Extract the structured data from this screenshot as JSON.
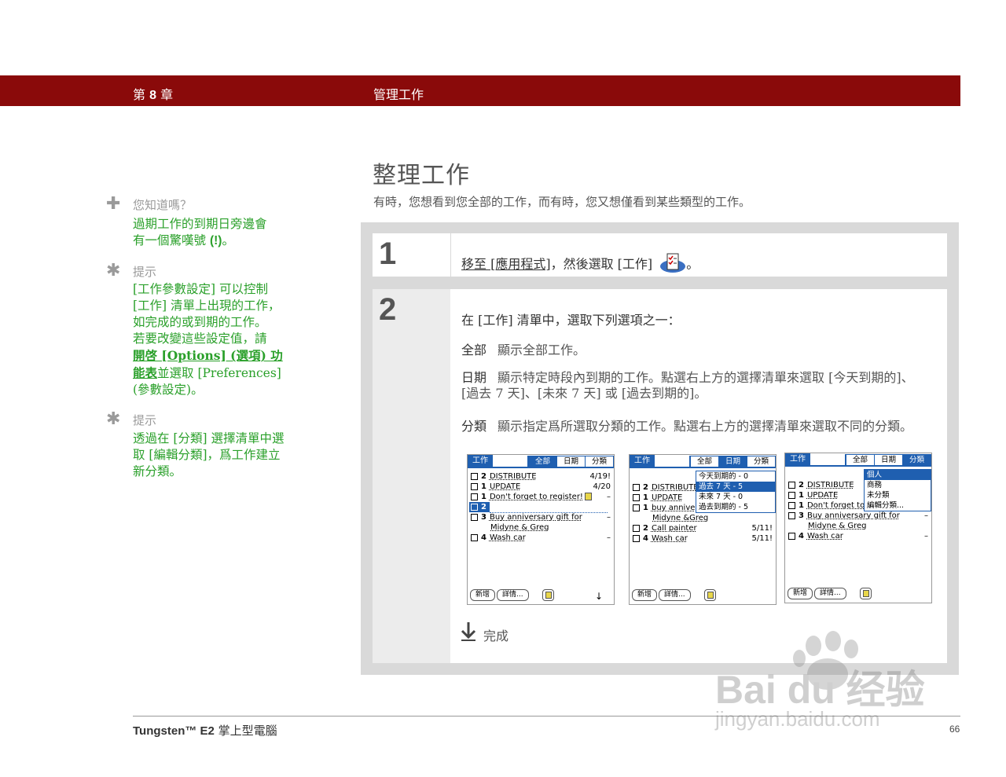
{
  "header": {
    "chapter_prefix": "第",
    "chapter_num": "8",
    "chapter_suffix": "章",
    "section": "管理工作",
    "color": "#8a0a0a"
  },
  "title": "整理工作",
  "intro": "有時，您想看到您全部的工作，而有時，您又想僅看到某些類型的工作。",
  "sidebar": {
    "did_you_know": {
      "icon": "plus-icon",
      "heading": "您知道嗎？",
      "body_1": "過期工作的到期日旁邊會",
      "body_2a": "有一個驚嘆號",
      "body_2b": "(!)",
      "body_2c": "。"
    },
    "tip1": {
      "icon": "asterisk-icon",
      "heading": "提示",
      "lines": [
        "[工作參數設定] 可以控制",
        "[工作] 清單上出現的工作，",
        "如完成的或到期的工作。",
        "若要改變這些設定值，請"
      ],
      "link_a": "開啓 [Options] (選項) 功",
      "link_b": "能表",
      "after_link": "並選取 [Preferences]",
      "last": "(參數設定)。"
    },
    "tip2": {
      "icon": "asterisk-icon",
      "heading": "提示",
      "lines": [
        "透過在 [分類] 選擇清單中選",
        "取 [編輯分類]，爲工作建立",
        "新分類。"
      ]
    }
  },
  "steps": {
    "step1": {
      "number": "1",
      "link": "移至 [應用程式]",
      "text": "，然後選取 [工作]",
      "end": "。",
      "icon": "tasks-app-icon"
    },
    "step2": {
      "number": "2",
      "lead": "在 [工作] 清單中，選取下列選項之一：",
      "opt_all_label": "全部",
      "opt_all_text": "顯示全部工作。",
      "opt_date_label": "日期",
      "opt_date_text_1": "顯示特定時段內到期的工作。點選右上方的選擇清單來選取 [今天到期的]、",
      "opt_date_text_2": "[過去 7 天]、[未來 7 天] 或 [過去到期的]。",
      "opt_cat_label": "分類",
      "opt_cat_text": "顯示指定爲所選取分類的工作。點選右上方的選擇清單來選取不同的分類。",
      "done": "完成",
      "done_icon": "arrow-down-icon"
    }
  },
  "screens": {
    "s1": {
      "app": "工作",
      "tabs": [
        "全部",
        "日期",
        "分類"
      ],
      "rows": [
        {
          "pr": "2",
          "desc": "DISTRIBUTE",
          "due": "4/19!"
        },
        {
          "pr": "1",
          "desc": "UPDATE",
          "due": "4/20"
        },
        {
          "pr": "1",
          "desc": "Don't forget to register!",
          "due": "–"
        },
        {
          "pr": "2",
          "desc": "",
          "due": ""
        },
        {
          "pr": "3",
          "desc": "Buy anniversary gift for",
          "due": "–"
        },
        {
          "pr": "",
          "desc": "Midyne & Greg",
          "due": ""
        },
        {
          "pr": "4",
          "desc": "Wash car",
          "due": "–"
        }
      ],
      "btn_new": "新增",
      "btn_details": "詳情...",
      "scroll": "↓"
    },
    "s2": {
      "app": "工作",
      "tabs": [
        "全部",
        "日期",
        "分類"
      ],
      "popup": [
        "今天到期的 - 0",
        "過去 7 天 - 5",
        "未來 7 天 - 0",
        "過去到期的 - 5"
      ],
      "rows": [
        {
          "pr": "2",
          "desc": "DISTRIBUTE",
          "due": ""
        },
        {
          "pr": "1",
          "desc": "UPDATE",
          "due": ""
        },
        {
          "pr": "1",
          "desc": "buy annive",
          "due": ""
        },
        {
          "pr": "",
          "desc": "Midyne &Greg",
          "due": ""
        },
        {
          "pr": "2",
          "desc": "Call painter",
          "due": "5/11!"
        },
        {
          "pr": "4",
          "desc": "Wash car",
          "due": "5/11!"
        }
      ],
      "btn_new": "新增",
      "btn_details": "詳情..."
    },
    "s3": {
      "app": "工作",
      "tabs": [
        "全部",
        "日期",
        "分類"
      ],
      "popup": [
        "個人",
        "商務",
        "未分類",
        "編輯分類..."
      ],
      "rows": [
        {
          "pr": "2",
          "desc": "DISTRIBUTE",
          "due": ""
        },
        {
          "pr": "1",
          "desc": "UPDATE",
          "due": ""
        },
        {
          "pr": "1",
          "desc": "Don't forget to",
          "due": ""
        },
        {
          "pr": "3",
          "desc": "Buy anniversary gift for",
          "due": "–"
        },
        {
          "pr": "",
          "desc": "Midyne & Greg",
          "due": ""
        },
        {
          "pr": "4",
          "desc": "Wash car",
          "due": "–"
        }
      ],
      "btn_new": "新增",
      "btn_details": "詳情..."
    }
  },
  "footer": {
    "product_a": "Tungsten™ E2",
    "product_b": " 掌上型電腦",
    "page": "66"
  },
  "watermark": {
    "line1": "Bai du 经验",
    "line2": "jingyan.baidu.com"
  }
}
